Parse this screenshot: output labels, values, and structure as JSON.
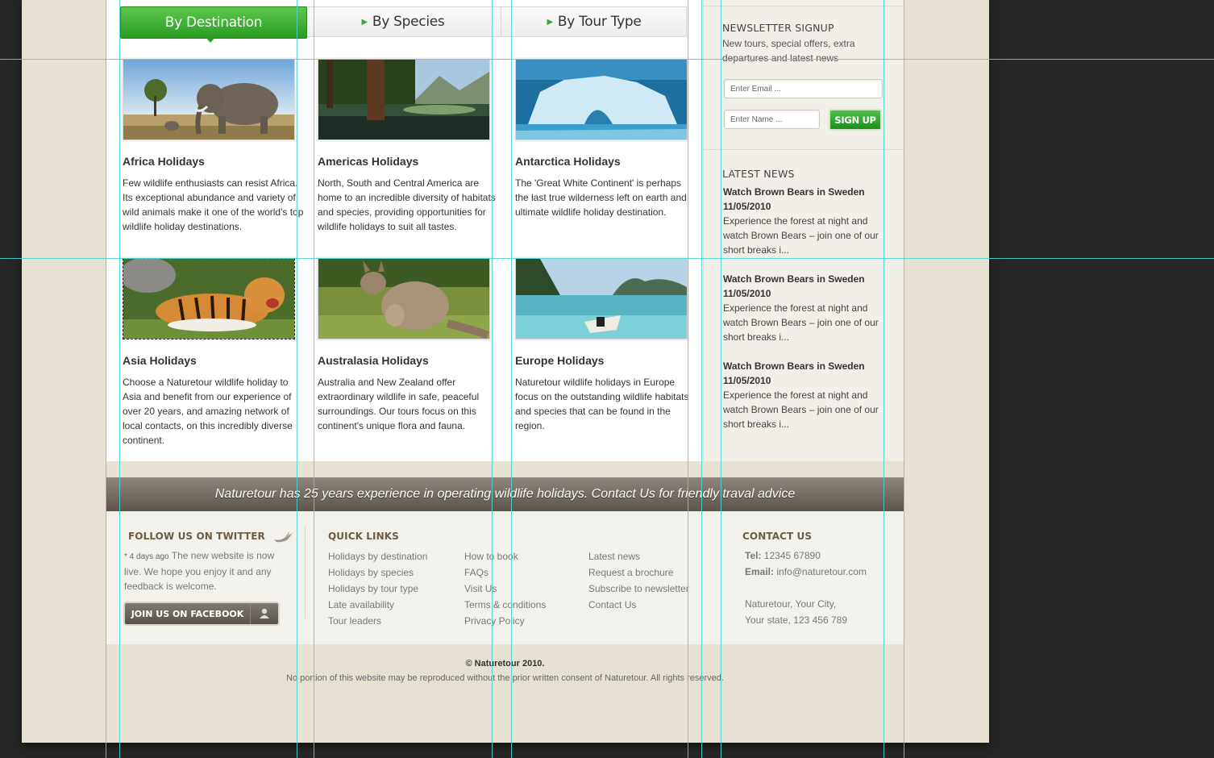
{
  "tabs": [
    {
      "label": "By Destination",
      "active": true
    },
    {
      "label": "By Species",
      "active": false
    },
    {
      "label": "By Tour Type",
      "active": false
    }
  ],
  "destinations": [
    {
      "title": "Africa Holidays",
      "text": "Few wildlife enthusiasts can resist Africa. Its exceptional abundance and variety of wild animals make it one of the world's top wildlife holiday destinations.",
      "image": "elephant-photo"
    },
    {
      "title": "Americas Holidays",
      "text": "North, South and Central America are home to an incredible diversity of habitats and species, providing opportunities for wildlife holidays to suit all tastes.",
      "image": "forest-lake-photo"
    },
    {
      "title": "Antarctica Holidays",
      "text": "The 'Great White Continent' is perhaps the last true wilderness left on earth and ultimate wildlife holiday destination.",
      "image": "iceberg-photo"
    },
    {
      "title": "Asia Holidays",
      "text": "Choose a Naturetour wildlife holiday to Asia and benefit from our experience of over 20 years, and amazing network of local contacts, on this incredibly diverse continent.",
      "image": "tiger-photo"
    },
    {
      "title": "Australasia Holidays",
      "text": "Australia and New Zealand offer extraordinary wildlife in safe, peaceful surroundings. Our tours focus on this continent's unique flora and fauna.",
      "image": "kangaroo-photo"
    },
    {
      "title": "Europe Holidays",
      "text": "Naturetour wildlife holidays in Europe focus on the outstanding wildlife habitats and species that can be found in the region.",
      "image": "boat-photo"
    }
  ],
  "newsletter": {
    "heading": "NEWSLETTER SIGNUP",
    "text": "New tours, special offers, extra departures and latest news",
    "email_placeholder": "Enter Email ...",
    "name_placeholder": "Enter Name ...",
    "button": "SIGN UP"
  },
  "news": {
    "heading": "LATEST NEWS",
    "items": [
      {
        "title": "Watch Brown Bears in Sweden",
        "date": "11/05/2010",
        "text": "Experience the forest at night and watch Brown Bears – join one of our short breaks i..."
      },
      {
        "title": "Watch Brown Bears in Sweden",
        "date": "11/05/2010",
        "text": "Experience the forest at night and watch Brown Bears – join one of our short breaks i..."
      },
      {
        "title": "Watch Brown Bears in Sweden",
        "date": "11/05/2010",
        "text": "Experience the forest at night and watch Brown Bears – join one of our short breaks i..."
      }
    ]
  },
  "banner": "Naturetour has 25 years experience in operating wildlife holidays.  Contact Us for friendly traval advice",
  "twitter": {
    "heading": "FOLLOW US ON TWITTER",
    "meta": "* 4 days ago",
    "text": "The new website is now live. We hope you enjoy it and any feedback is welcome.",
    "facebook_button": "JOIN US ON FACEBOOK"
  },
  "quick_links": {
    "heading": "QUICK LINKS",
    "col1": [
      "Holidays by destination",
      "Holidays by species",
      "Holidays by tour type",
      "Late availability",
      "Tour leaders"
    ],
    "col2": [
      "How to book",
      "FAQs",
      "Visit Us",
      "Terms & conditions",
      "Privacy Policy"
    ],
    "col3": [
      "Latest news",
      "Request a brochure",
      "Subscribe to newsletter",
      "Contact Us"
    ]
  },
  "contact": {
    "heading": "CONTACT US",
    "tel_label": "Tel:",
    "tel": "12345 67890",
    "email_label": "Email:",
    "email": "info@naturetour.com",
    "address1": "Naturetour, Your City,",
    "address2": "Your state, 123 456 789"
  },
  "copyright": "© Naturetour 2010.",
  "disclaimer": "No portion of this website may be reproduced without the prior written consent of Naturetour. All rights reserved.",
  "colors": {
    "accent_green": "#2a9c22",
    "banner_brown": "#6f675c",
    "footer_heading": "#6b5d45"
  }
}
